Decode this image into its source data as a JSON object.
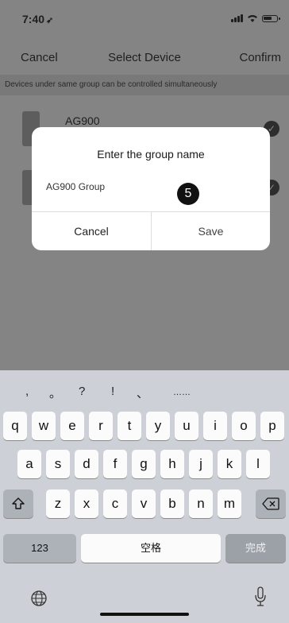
{
  "status": {
    "time": "7:40"
  },
  "nav": {
    "cancel": "Cancel",
    "title": "Select Device",
    "confirm": "Confirm"
  },
  "hint": "Devices under same group can be controlled simultaneously",
  "devices": [
    {
      "name": "AG900"
    }
  ],
  "dialog": {
    "title": "Enter the group name",
    "input_value": "AG900 Group",
    "step_badge": "5",
    "cancel": "Cancel",
    "save": "Save"
  },
  "keyboard": {
    "punct": [
      ",",
      "。",
      "?",
      "!",
      "、",
      "……"
    ],
    "row1": [
      "q",
      "w",
      "e",
      "r",
      "t",
      "y",
      "u",
      "i",
      "o",
      "p"
    ],
    "row2": [
      "a",
      "s",
      "d",
      "f",
      "g",
      "h",
      "j",
      "k",
      "l"
    ],
    "row3": [
      "z",
      "x",
      "c",
      "v",
      "b",
      "n",
      "m"
    ],
    "numbers_key": "123",
    "space_key": "空格",
    "done_key": "完成"
  }
}
